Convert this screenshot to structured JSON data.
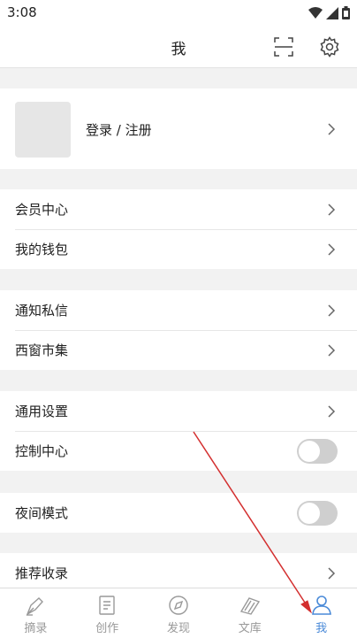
{
  "status": {
    "time": "3:08"
  },
  "header": {
    "title": "我"
  },
  "profile": {
    "login_label": "登录 / 注册"
  },
  "sections": [
    {
      "items": [
        {
          "label": "会员中心"
        },
        {
          "label": "我的钱包"
        }
      ]
    },
    {
      "items": [
        {
          "label": "通知私信"
        },
        {
          "label": "西窗市集"
        }
      ]
    },
    {
      "items": [
        {
          "label": "通用设置"
        },
        {
          "label": "控制中心",
          "toggle": false
        }
      ]
    },
    {
      "items": [
        {
          "label": "夜间模式",
          "toggle": false
        }
      ]
    },
    {
      "items": [
        {
          "label": "推荐收录"
        }
      ]
    }
  ],
  "tabs": [
    {
      "label": "摘录",
      "icon": "pen-icon"
    },
    {
      "label": "创作",
      "icon": "document-icon"
    },
    {
      "label": "发现",
      "icon": "compass-icon"
    },
    {
      "label": "文库",
      "icon": "books-icon"
    },
    {
      "label": "我",
      "icon": "person-icon",
      "active": true
    }
  ],
  "colors": {
    "accent": "#4a8ad8",
    "annotation_arrow": "#d32f2f"
  }
}
